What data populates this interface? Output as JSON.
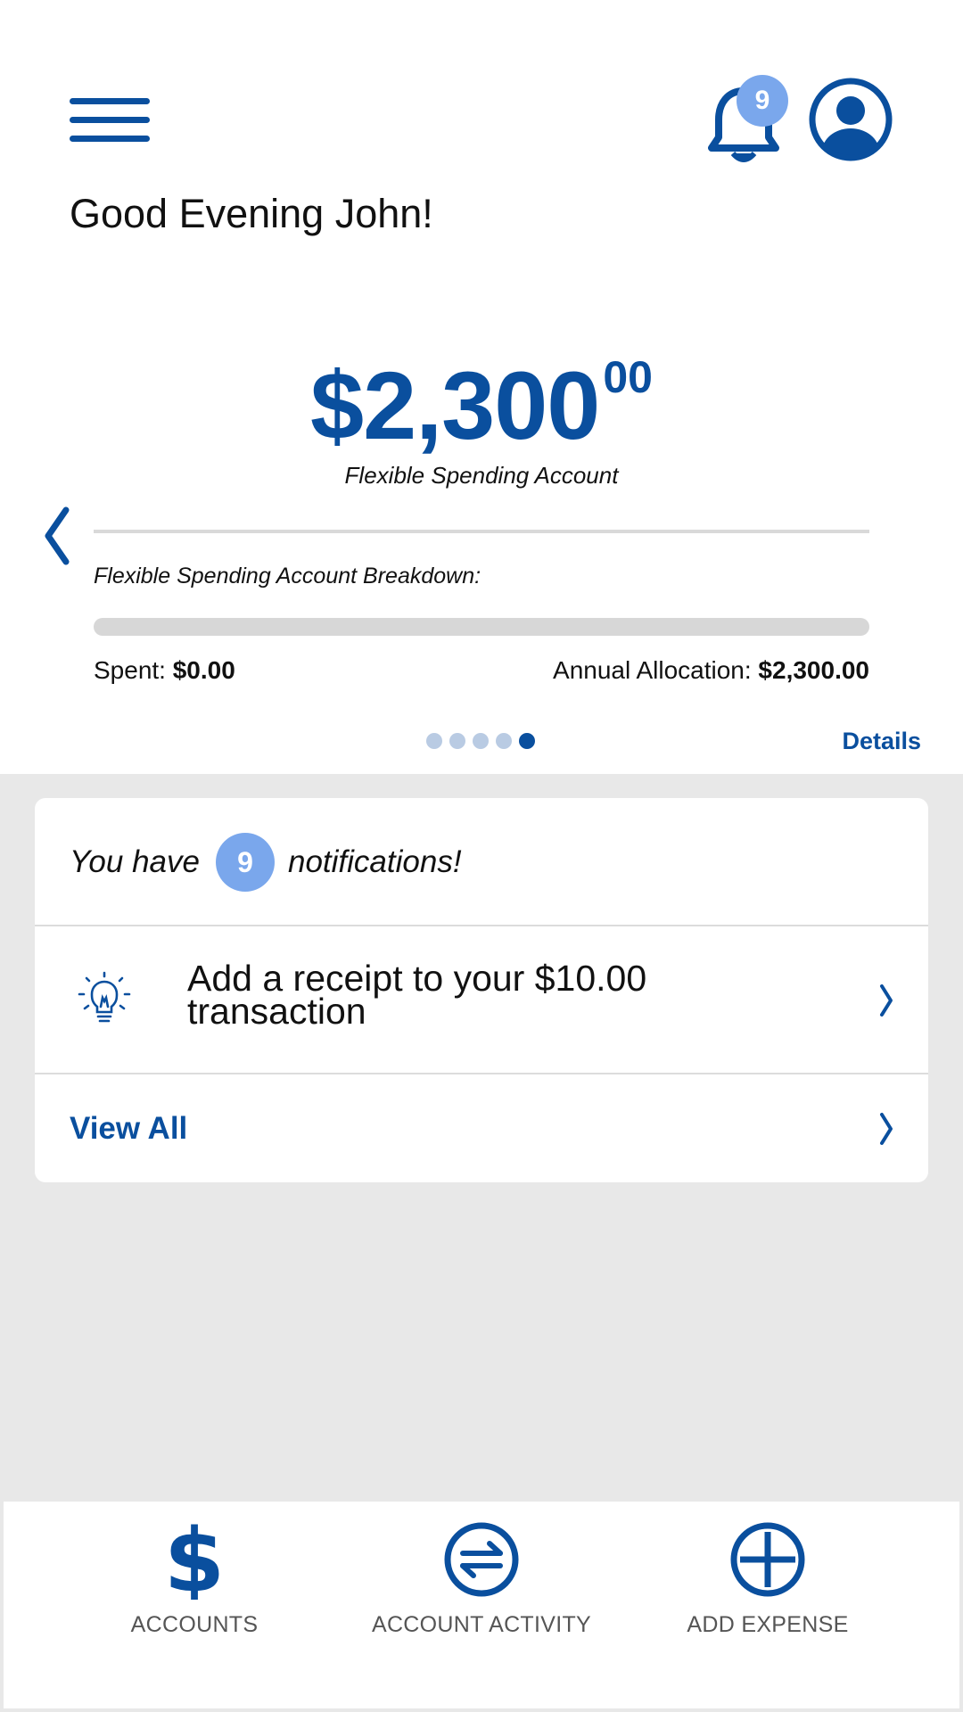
{
  "header": {
    "notification_count": "9"
  },
  "greeting": "Good Evening John!",
  "balance": {
    "main": "$2,300",
    "cents": "00",
    "account_label": "Flexible Spending Account"
  },
  "breakdown": {
    "title": "Flexible Spending Account Breakdown:",
    "progress_fraction": 0,
    "spent_label": "Spent:",
    "spent_value": "$0.00",
    "allocation_label": "Annual Allocation:",
    "allocation_value": "$2,300.00"
  },
  "pager": {
    "total": 5,
    "active_index": 4,
    "details_label": "Details"
  },
  "notifications": {
    "prefix": "You have",
    "count": "9",
    "suffix": "notifications!",
    "items": [
      {
        "text": "Add a receipt to your $10.00 transaction",
        "icon": "lightbulb-icon"
      }
    ],
    "view_all_label": "View All"
  },
  "bottom_nav": [
    {
      "label": "ACCOUNTS",
      "icon": "dollar-icon"
    },
    {
      "label": "ACCOUNT ACTIVITY",
      "icon": "transfer-arrows-icon"
    },
    {
      "label": "ADD EXPENSE",
      "icon": "plus-circle-icon"
    }
  ],
  "colors": {
    "brand_blue": "#0a4f9e",
    "badge_blue": "#7aa7ec",
    "background_gray": "#e8e8e8"
  }
}
